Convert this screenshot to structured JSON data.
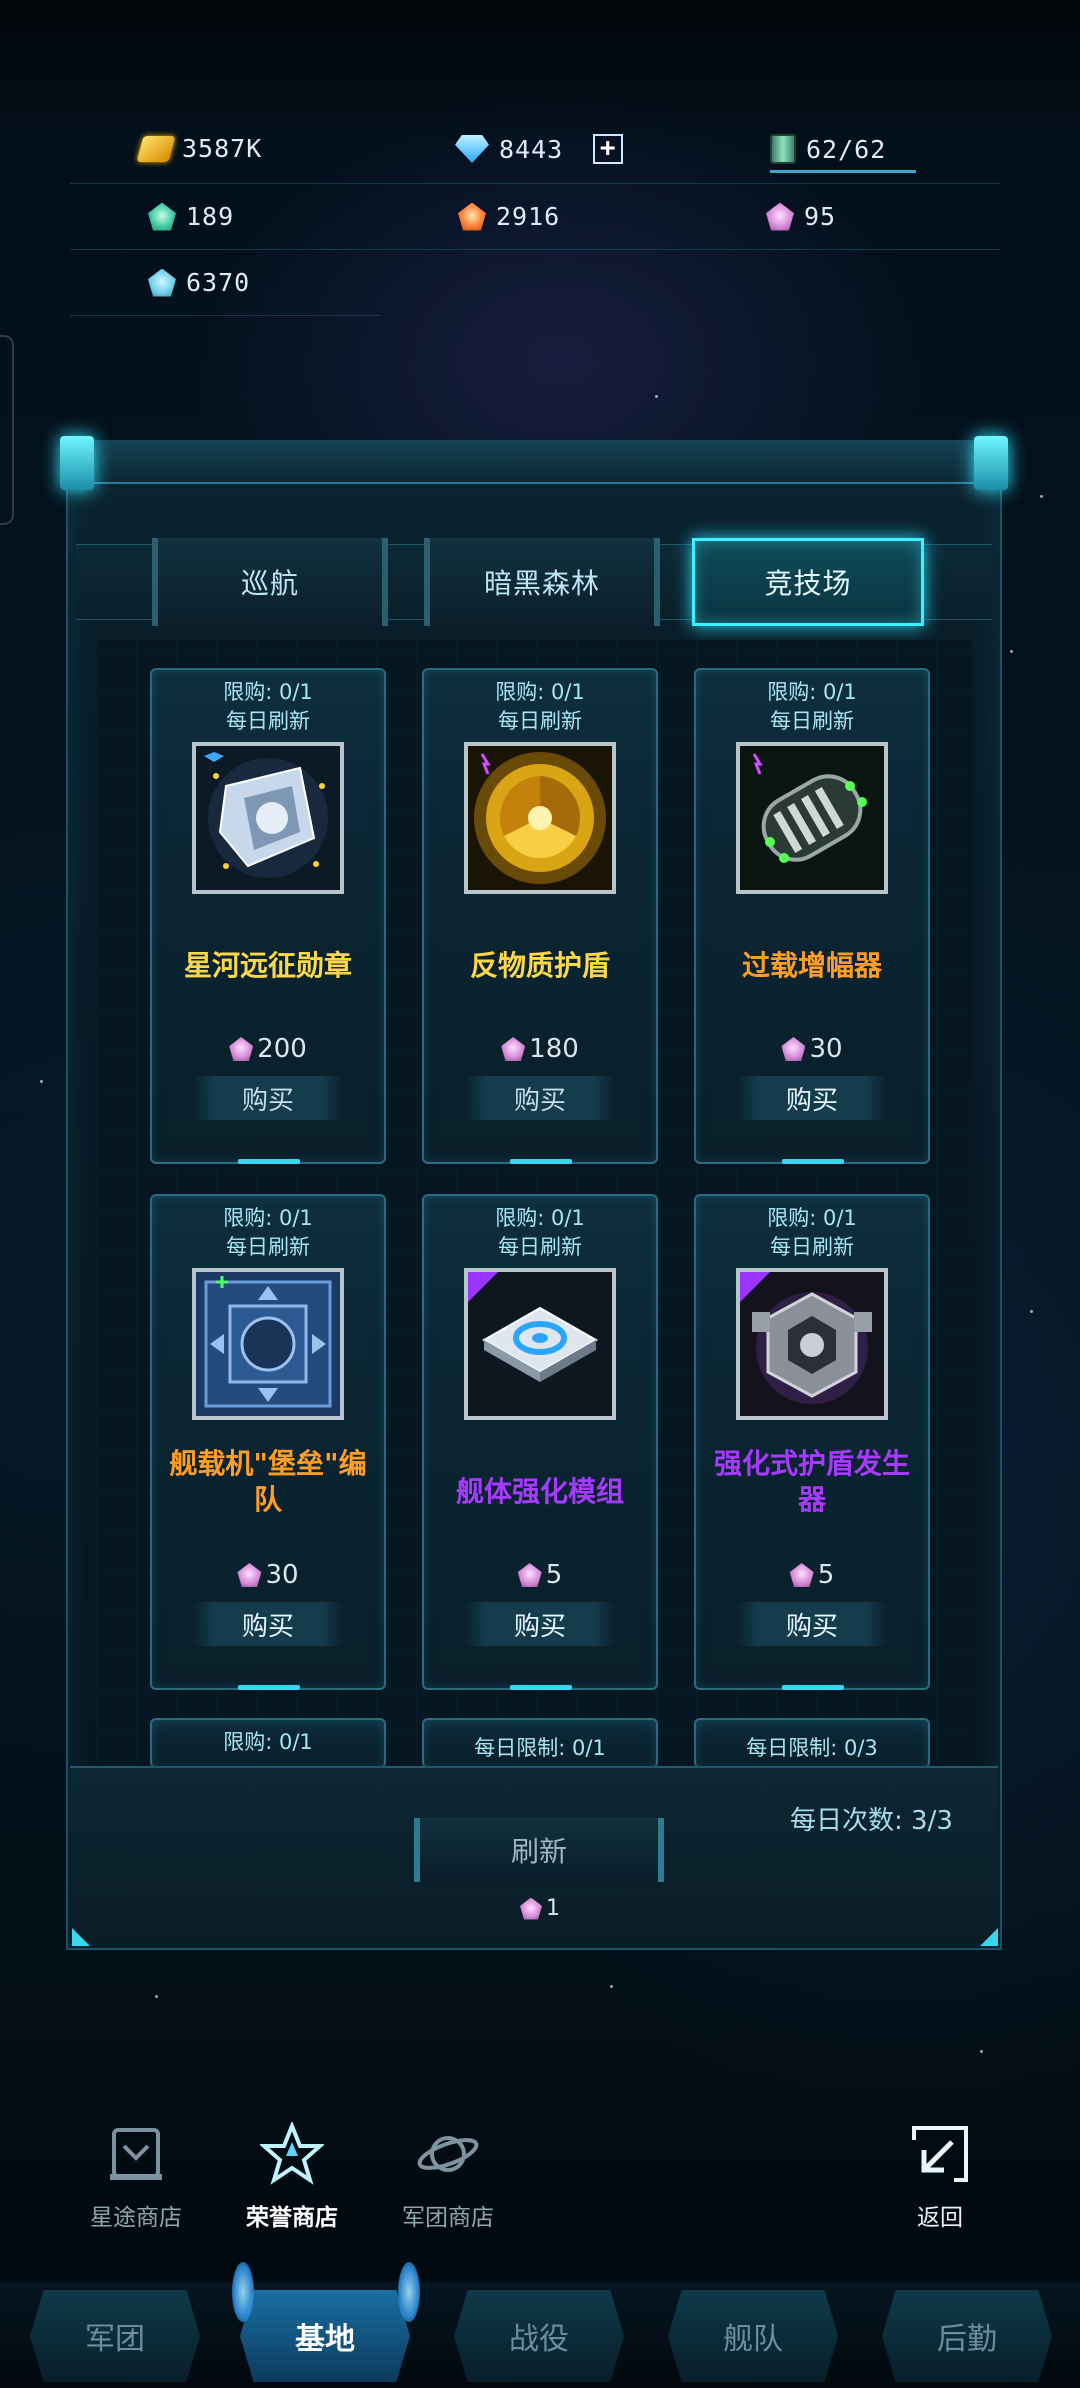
{
  "resources": {
    "gold": "3587K",
    "diamond": "8443",
    "capacity": "62/62",
    "gem_teal": "189",
    "gem_orange": "2916",
    "gem_pink": "95",
    "gem_cyan": "6370"
  },
  "tabs": [
    "巡航",
    "暗黑森林",
    "竞技场"
  ],
  "active_tab": "竞技场",
  "cards": [
    {
      "limit": "限购: 0/1",
      "refresh": "每日刷新",
      "name": "星河远征勋章",
      "price": "200",
      "buy": "购买",
      "name_color": "#ffd84a"
    },
    {
      "limit": "限购: 0/1",
      "refresh": "每日刷新",
      "name": "反物质护盾",
      "price": "180",
      "buy": "购买",
      "name_color": "#ffd84a"
    },
    {
      "limit": "限购: 0/1",
      "refresh": "每日刷新",
      "name": "过载增幅器",
      "price": "30",
      "buy": "购买",
      "name_color": "#ff9d24"
    },
    {
      "limit": "限购: 0/1",
      "refresh": "每日刷新",
      "name": "舰载机\"堡垒\"编队",
      "price": "30",
      "buy": "购买",
      "name_color": "#ff9d24"
    },
    {
      "limit": "限购: 0/1",
      "refresh": "每日刷新",
      "name": "舰体强化模组",
      "price": "5",
      "buy": "购买",
      "name_color": "#a63bff"
    },
    {
      "limit": "限购: 0/1",
      "refresh": "每日刷新",
      "name": "强化式护盾发生器",
      "price": "5",
      "buy": "购买",
      "name_color": "#a63bff"
    }
  ],
  "partial_cards": [
    "限购: 0/1",
    "每日限制: 0/1",
    "每日限制: 0/3"
  ],
  "daily_count": "每日次数: 3/3",
  "refresh_button": "刷新",
  "refresh_cost": "1",
  "shop_nav": [
    {
      "label": "星途商店",
      "icon": "star-route-shop-icon"
    },
    {
      "label": "荣誉商店",
      "icon": "honor-shop-icon"
    },
    {
      "label": "军团商店",
      "icon": "legion-shop-icon"
    }
  ],
  "back_label": "返回",
  "bottom_tabs": [
    "军团",
    "基地",
    "战役",
    "舰队",
    "后勤"
  ],
  "active_bottom_tab": "基地"
}
